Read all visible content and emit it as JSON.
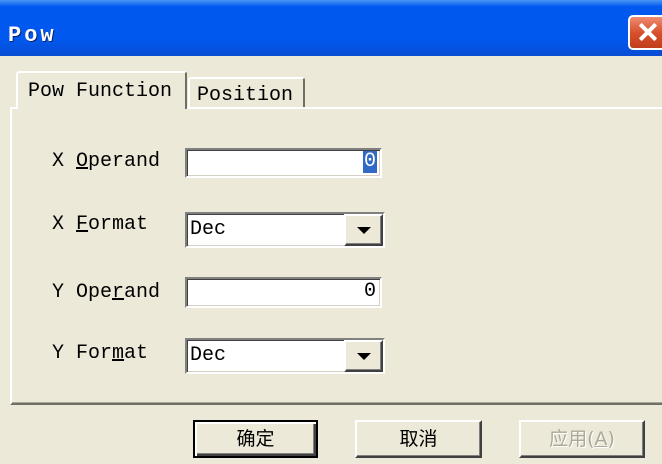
{
  "window": {
    "title": "Pow"
  },
  "icons": {
    "close": "close-icon",
    "dropdown": "dropdown-arrow-icon"
  },
  "colors": {
    "title_bar": "#0058EE",
    "dialog_bg": "#ECE9D8",
    "selection_bg": "#316AC5",
    "close_button": "#D8512F",
    "disabled_text": "#ACA899"
  },
  "tabs": [
    {
      "label": "Pow Function",
      "selected": true
    },
    {
      "label": "Position",
      "selected": false
    }
  ],
  "form": {
    "x_operand": {
      "label": "X Operand",
      "access_key": "O",
      "value": "0",
      "text_selected": true
    },
    "x_format": {
      "label": "X Format",
      "access_key": "F",
      "value": "Dec"
    },
    "y_operand": {
      "label": "Y Operand",
      "access_key": "r",
      "value": "0",
      "text_selected": false
    },
    "y_format": {
      "label": "Y Format",
      "access_key": "m",
      "value": "Dec"
    }
  },
  "buttons": {
    "ok": {
      "label": "确定",
      "default": true,
      "disabled": false
    },
    "cancel": {
      "label": "取消",
      "default": false,
      "disabled": false
    },
    "apply": {
      "label": "应用(A)",
      "access_key": "A",
      "default": false,
      "disabled": true
    }
  }
}
